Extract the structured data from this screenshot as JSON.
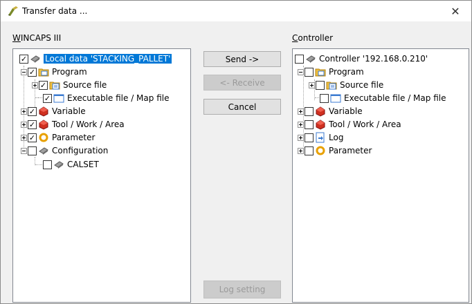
{
  "window": {
    "title": "Transfer data ...",
    "close_glyph": "✕"
  },
  "left_panel": {
    "label": "WINCAPS III",
    "tree": [
      {
        "label": "Local data 'STACKING_PALLET'",
        "checked": true,
        "icon": "robot-icon",
        "selected": true
      },
      {
        "label": "Program",
        "checked": true,
        "icon": "folder-program-icon"
      },
      {
        "label": "Source file",
        "checked": true,
        "icon": "folder-doc-icon"
      },
      {
        "label": "Executable file / Map file",
        "checked": true,
        "icon": "window-file-icon"
      },
      {
        "label": "Variable",
        "checked": true,
        "icon": "variable-icon"
      },
      {
        "label": "Tool / Work / Area",
        "checked": true,
        "icon": "tool-icon"
      },
      {
        "label": "Parameter",
        "checked": true,
        "icon": "parameter-icon"
      },
      {
        "label": "Configuration",
        "checked": false,
        "icon": "configuration-icon"
      },
      {
        "label": "CALSET",
        "checked": false,
        "icon": "calset-icon"
      }
    ]
  },
  "right_panel": {
    "label": "Controller",
    "tree": [
      {
        "label": "Controller '192.168.0.210'",
        "checked": false,
        "icon": "robot-icon"
      },
      {
        "label": "Program",
        "checked": false,
        "icon": "folder-program-icon"
      },
      {
        "label": "Source file",
        "checked": false,
        "icon": "folder-doc-icon"
      },
      {
        "label": "Executable file / Map file",
        "checked": false,
        "icon": "window-file-icon"
      },
      {
        "label": "Variable",
        "checked": false,
        "icon": "variable-icon"
      },
      {
        "label": "Tool / Work / Area",
        "checked": false,
        "icon": "tool-icon"
      },
      {
        "label": "Log",
        "checked": false,
        "icon": "log-icon"
      },
      {
        "label": "Parameter",
        "checked": false,
        "icon": "parameter-icon"
      }
    ]
  },
  "buttons": {
    "send": "Send ->",
    "receive": "<- Receive",
    "cancel": "Cancel",
    "log_setting": "Log setting"
  },
  "colors": {
    "selection": "#0078d7",
    "disabled_text": "#9a9a9a"
  }
}
